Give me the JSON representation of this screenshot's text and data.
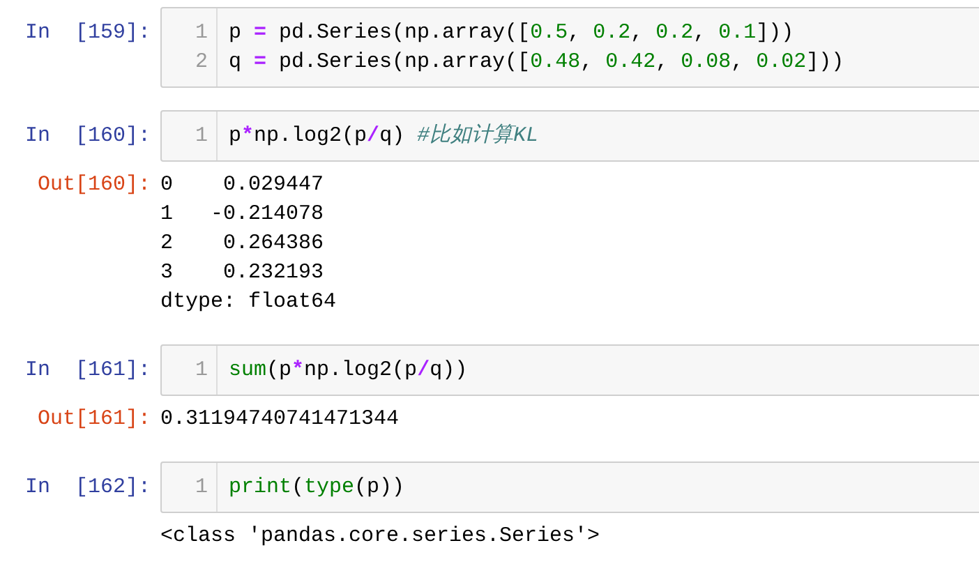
{
  "cells": [
    {
      "prompt": "In  [159]:",
      "lines": [
        {
          "number": "1",
          "tokens": [
            {
              "kind": "text",
              "text": "p "
            },
            {
              "kind": "operator",
              "text": "="
            },
            {
              "kind": "text",
              "text": " pd.Series(np.array(["
            },
            {
              "kind": "number",
              "text": "0.5"
            },
            {
              "kind": "text",
              "text": ", "
            },
            {
              "kind": "number",
              "text": "0.2"
            },
            {
              "kind": "text",
              "text": ", "
            },
            {
              "kind": "number",
              "text": "0.2"
            },
            {
              "kind": "text",
              "text": ", "
            },
            {
              "kind": "number",
              "text": "0.1"
            },
            {
              "kind": "text",
              "text": "]))"
            }
          ]
        },
        {
          "number": "2",
          "tokens": [
            {
              "kind": "text",
              "text": "q "
            },
            {
              "kind": "operator",
              "text": "="
            },
            {
              "kind": "text",
              "text": " pd.Series(np.array(["
            },
            {
              "kind": "number",
              "text": "0.48"
            },
            {
              "kind": "text",
              "text": ", "
            },
            {
              "kind": "number",
              "text": "0.42"
            },
            {
              "kind": "text",
              "text": ", "
            },
            {
              "kind": "number",
              "text": "0.08"
            },
            {
              "kind": "text",
              "text": ", "
            },
            {
              "kind": "number",
              "text": "0.02"
            },
            {
              "kind": "text",
              "text": "]))"
            }
          ]
        }
      ]
    },
    {
      "prompt": "In  [160]:",
      "lines": [
        {
          "number": "1",
          "tokens": [
            {
              "kind": "text",
              "text": "p"
            },
            {
              "kind": "operator",
              "text": "*"
            },
            {
              "kind": "text",
              "text": "np.log2(p"
            },
            {
              "kind": "operator",
              "text": "/"
            },
            {
              "kind": "text",
              "text": "q) "
            },
            {
              "kind": "comment",
              "text": "#比如计算KL"
            }
          ]
        }
      ],
      "output": {
        "prompt": "Out[160]:",
        "lines": [
          "0    0.029447",
          "1   -0.214078",
          "2    0.264386",
          "3    0.232193",
          "dtype: float64"
        ]
      }
    },
    {
      "prompt": "In  [161]:",
      "lines": [
        {
          "number": "1",
          "tokens": [
            {
              "kind": "builtin",
              "text": "sum"
            },
            {
              "kind": "text",
              "text": "(p"
            },
            {
              "kind": "operator",
              "text": "*"
            },
            {
              "kind": "text",
              "text": "np.log2(p"
            },
            {
              "kind": "operator",
              "text": "/"
            },
            {
              "kind": "text",
              "text": "q))"
            }
          ]
        }
      ],
      "output": {
        "prompt": "Out[161]:",
        "lines": [
          "0.31194740741471344"
        ]
      }
    },
    {
      "prompt": "In  [162]:",
      "lines": [
        {
          "number": "1",
          "tokens": [
            {
              "kind": "builtin",
              "text": "print"
            },
            {
              "kind": "text",
              "text": "("
            },
            {
              "kind": "builtin",
              "text": "type"
            },
            {
              "kind": "text",
              "text": "(p))"
            }
          ]
        }
      ],
      "output": {
        "lines": [
          "<class 'pandas.core.series.Series'>"
        ]
      }
    }
  ]
}
